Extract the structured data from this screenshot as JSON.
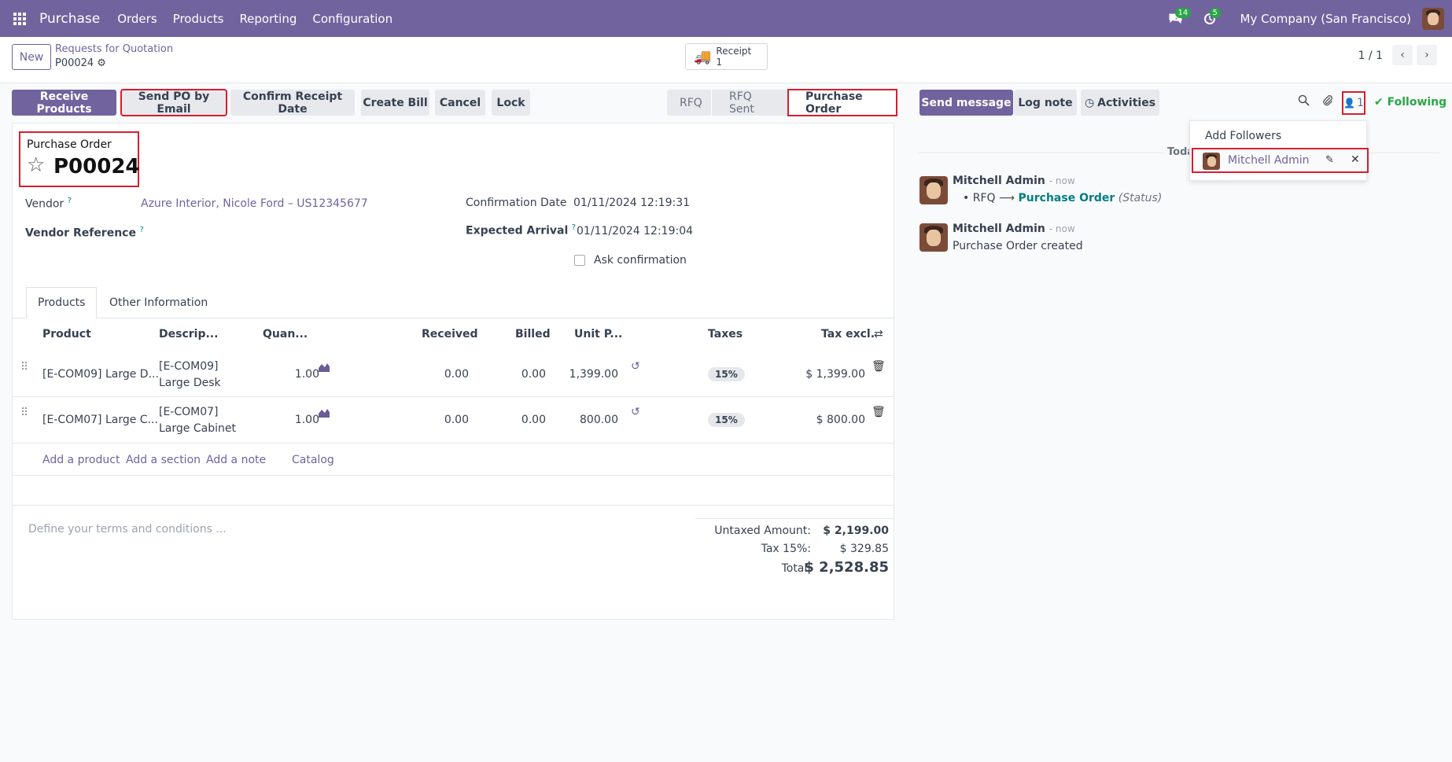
{
  "nav": {
    "app_name": "Purchase",
    "menu": [
      "Orders",
      "Products",
      "Reporting",
      "Configuration"
    ],
    "messages_count": "14",
    "activities_count": "5",
    "company": "My Company (San Francisco)"
  },
  "control_panel": {
    "new_label": "New",
    "breadcrumb_parent": "Requests for Quotation",
    "breadcrumb_current": "P00024",
    "smart_button": {
      "label": "Receipt",
      "count": "1"
    },
    "pager": "1 / 1"
  },
  "actions": {
    "receive_products": "Receive Products",
    "send_po_email": "Send PO by Email",
    "confirm_receipt_date": "Confirm Receipt Date",
    "create_bill": "Create Bill",
    "cancel": "Cancel",
    "lock": "Lock"
  },
  "stages": [
    "RFQ",
    "RFQ Sent",
    "Purchase Order"
  ],
  "form": {
    "title_label": "Purchase Order",
    "number": "P00024",
    "vendor_label": "Vendor",
    "vendor_value": "Azure Interior, Nicole Ford – US12345677",
    "vendor_ref_label": "Vendor Reference",
    "confirmation_date_label": "Confirmation Date",
    "confirmation_date_value": "01/11/2024 12:19:31",
    "expected_arrival_label": "Expected Arrival",
    "expected_arrival_value": "01/11/2024 12:19:04",
    "ask_confirmation_label": "Ask confirmation",
    "help_mark": "?"
  },
  "tabs": [
    "Products",
    "Other Information"
  ],
  "table": {
    "headers": [
      "Product",
      "Descrip...",
      "Quan...",
      "Received",
      "Billed",
      "Unit P...",
      "Taxes",
      "Tax excl."
    ],
    "rows": [
      {
        "product": "[E-COM09] Large D...",
        "desc1": "[E-COM09]",
        "desc2": "Large Desk",
        "qty": "1.00",
        "received": "0.00",
        "billed": "0.00",
        "unit_price": "1,399.00",
        "tax": "15%",
        "subtotal": "$ 1,399.00"
      },
      {
        "product": "[E-COM07] Large C...",
        "desc1": "[E-COM07]",
        "desc2": "Large Cabinet",
        "qty": "1.00",
        "received": "0.00",
        "billed": "0.00",
        "unit_price": "800.00",
        "tax": "15%",
        "subtotal": "$ 800.00"
      }
    ],
    "add_links": [
      "Add a product",
      "Add a section",
      "Add a note",
      "Catalog"
    ]
  },
  "terms_placeholder": "Define your terms and conditions ...",
  "totals": {
    "untaxed_label": "Untaxed Amount:",
    "untaxed_value": "$ 2,199.00",
    "tax_label": "Tax 15%:",
    "tax_value": "$ 329.85",
    "total_label": "Total:",
    "total_value": "$ 2,528.85"
  },
  "chatter": {
    "send_message": "Send message",
    "log_note": "Log note",
    "activities": "Activities",
    "followers_count": "1",
    "following": "Following",
    "today": "Toda",
    "dropdown": {
      "add_followers": "Add Followers",
      "follower_name": "Mitchell Admin"
    },
    "messages": [
      {
        "author": "Mitchell Admin",
        "time": "- now",
        "from": "RFQ",
        "to": "Purchase Order",
        "field": "(Status)"
      },
      {
        "author": "Mitchell Admin",
        "time": "- now",
        "body": "Purchase Order created"
      }
    ]
  }
}
